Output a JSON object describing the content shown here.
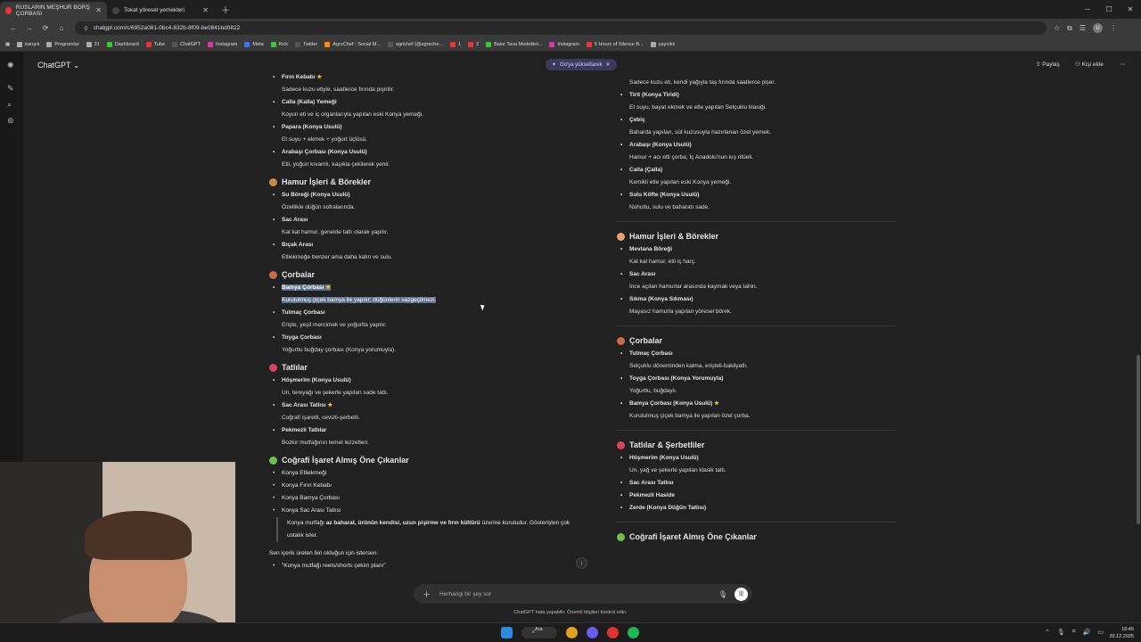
{
  "browser": {
    "tabs": [
      {
        "label": "RUSLARIN MEŞHUR BORŞ ÇORBASI",
        "favicon_color": "#e33"
      },
      {
        "label": "Tokat yöresel yemekleri",
        "favicon_color": "#222"
      }
    ],
    "url": "chatgpt.com/c/6952a081-0bc4-832b-8f09-be0841bd0822",
    "bookmarks": [
      {
        "label": "karışık",
        "color": "#aaa"
      },
      {
        "label": "Programlar",
        "color": "#aaa"
      },
      {
        "label": "31",
        "color": "#aaa"
      },
      {
        "label": "Dashboard",
        "color": "#3c3"
      },
      {
        "label": "Tube",
        "color": "#e33"
      },
      {
        "label": "ChatGPT",
        "color": "#222"
      },
      {
        "label": "Instagram",
        "color": "#d3a"
      },
      {
        "label": "Meta",
        "color": "#37f"
      },
      {
        "label": "Kick",
        "color": "#3c3"
      },
      {
        "label": "Twitter",
        "color": "#222"
      },
      {
        "label": "AgroChef - Social M...",
        "color": "#f80"
      },
      {
        "label": "agrichef (@agreche...",
        "color": "#222"
      },
      {
        "label": "1",
        "color": "#e33"
      },
      {
        "label": "2",
        "color": "#e33"
      },
      {
        "label": "Baior Tava Modelleri...",
        "color": "#3c3"
      },
      {
        "label": "Instagram",
        "color": "#d3a"
      },
      {
        "label": "5 Hours of Silence B...",
        "color": "#e33"
      },
      {
        "label": "yayınlık",
        "color": "#aaa"
      }
    ]
  },
  "app": {
    "title": "ChatGPT",
    "upgrade_label": "Go'ya yükseltarek",
    "share_label": "Paylaş",
    "add_person_label": "Kişi ekle"
  },
  "left": {
    "top_items": [
      {
        "name": "Fırın Kebabı",
        "star": true,
        "desc": "Sadece kuzu etiyle, saatlerce fırında pişirilir."
      },
      {
        "name": "Calla (Kalla) Yemeği",
        "star": false,
        "desc": "Koyun eti ve iç organlarıyla yapılan eski Konya yemeği."
      },
      {
        "name": "Papara (Konya Usulü)",
        "star": false,
        "desc": "Et suyu + ekmek + yoğurt üçlüsü."
      },
      {
        "name": "Arabaşı Çorbası (Konya Usulü)",
        "star": false,
        "desc": "Etli, yoğun kıvamlı, kaşıkla çekilerek yenir."
      }
    ],
    "hamur_title": "Hamur İşleri & Börekler",
    "hamur": [
      {
        "name": "Su Böreği (Konya Usulü)",
        "desc": "Özellikle düğün sofralarında."
      },
      {
        "name": "Sac Arası",
        "desc": "Kat kat hamur, genelde tatlı olarak yapılır."
      },
      {
        "name": "Bıçak Arası",
        "desc": "Etliekmeğe benzer ama daha kalın ve sulu."
      }
    ],
    "corba_title": "Çorbalar",
    "corba_hl_name": "Bamya Çorbası",
    "corba_hl_desc": "Kurutulmuş çiçek bamya ile yapılır; düğünlerin vazgeçilmezi.",
    "corba": [
      {
        "name": "Tutmaç Çorbası",
        "desc": "Erişte, yeşil mercimek ve yoğurtla yapılır."
      },
      {
        "name": "Toyga Çorbası",
        "desc": "Yoğurtlu buğday çorbası (Konya yorumuyla)."
      }
    ],
    "tatli_title": "Tatlılar",
    "tatli": [
      {
        "name": "Höşmerim (Konya Usulü)",
        "star": false,
        "desc": "Un, tereyağı ve şekerle yapılan sade tatlı."
      },
      {
        "name": "Sac Arası Tatlısı",
        "star": true,
        "desc": "Coğrafi işaretli, cevizli-şerbetli."
      },
      {
        "name": "Pekmezli Tatlılar",
        "star": false,
        "desc": "Bozkır mutfağının temel lezzetleri."
      }
    ],
    "cografi_title": "Coğrafi İşaret Almış Öne Çıkanlar",
    "cografi": [
      "Konya Etliekmeği",
      "Konya Fırın Kebabı",
      "Konya Bamya Çorbası",
      "Konya Sac Arası Tatlısı"
    ],
    "quote_pre": "Konya mutfağı ",
    "quote_bold": "az baharat, ürünün kendisi, uzun pişirme ve fırın kültürü",
    "quote_post": " üzerine kuruludur. Gösterişten çok ustalık ister.",
    "followup": "Sen içerik üreten biri olduğun için istersen:",
    "followup_item": "\"Konya mutfağı reels/shorts çekim planı\""
  },
  "right": {
    "top_desc": "Sadece kuzu eti, kendi yağıyla taş fırında saatlerce pişer.",
    "top_items": [
      {
        "name": "Tirit (Konya Tiridi)",
        "desc": "Et suyu, bayat ekmek ve etle yapılan Selçuklu klasiği."
      },
      {
        "name": "Çebiç",
        "desc": "Baharda yapılan, süt kuzusuyla hazırlanan özel yemek."
      },
      {
        "name": "Arabaşı (Konya Usulü)",
        "desc": "Hamur + acı etli çorba; İç Anadolu'nun kış ritüeli."
      },
      {
        "name": "Calla (Çalla)",
        "desc": "Kemikli etle yapılan eski Konya yemeği."
      },
      {
        "name": "Sulu Köfte (Konya Usulü)",
        "desc": "Nohutlu, sulu ve baharatı sade."
      }
    ],
    "hamur_title": "Hamur İşleri & Börekler",
    "hamur": [
      {
        "name": "Mevlana Böreği",
        "desc": "Kat kat hamur, etli iç harç."
      },
      {
        "name": "Sac Arası",
        "desc": "İnce açılan hamurlar arasında kaymak veya tahin."
      },
      {
        "name": "Sıkma (Konya Sıkması)",
        "desc": "Mayasız hamurla yapılan yöresel börek."
      }
    ],
    "corba_title": "Çorbalar",
    "corba": [
      {
        "name": "Tutmaç Çorbası",
        "star": false,
        "desc": "Selçuklu döneminden kalma, erişteli-bakliyatlı."
      },
      {
        "name": "Toyga Çorbası (Konya Yorumuyla)",
        "star": false,
        "desc": "Yoğurtlu, buğdaylı."
      },
      {
        "name": "Bamya Çorbası (Konya Usulü)",
        "star": true,
        "desc": "Kurutulmuş çiçek bamya ile yapılan özel çorba."
      }
    ],
    "tatli_title": "Tatlılar & Şerbetliler",
    "tatli": [
      {
        "name": "Höşmerim (Konya Usulü)",
        "desc": "Un, yağ ve şekerle yapılan klasik tatlı."
      },
      {
        "name": "Sac Arası Tatlısı",
        "desc": ""
      },
      {
        "name": "Pekmezli Haside",
        "desc": ""
      },
      {
        "name": "Zerde (Konya Düğün Tatlısı)",
        "desc": ""
      }
    ],
    "cografi_title": "Coğrafi İşaret Almış Öne Çıkanlar"
  },
  "composer": {
    "placeholder": "Herhangi bir şey sor",
    "disclaimer": "ChatGPT hata yapabilir. Önemli bilgileri kontrol edin."
  },
  "taskbar": {
    "search_label": "Ara",
    "time": "18:45",
    "date": "29.12.2025"
  },
  "colors": {
    "highlight": "#5f6f8f",
    "star": "#f6c343",
    "background": "#212121"
  }
}
